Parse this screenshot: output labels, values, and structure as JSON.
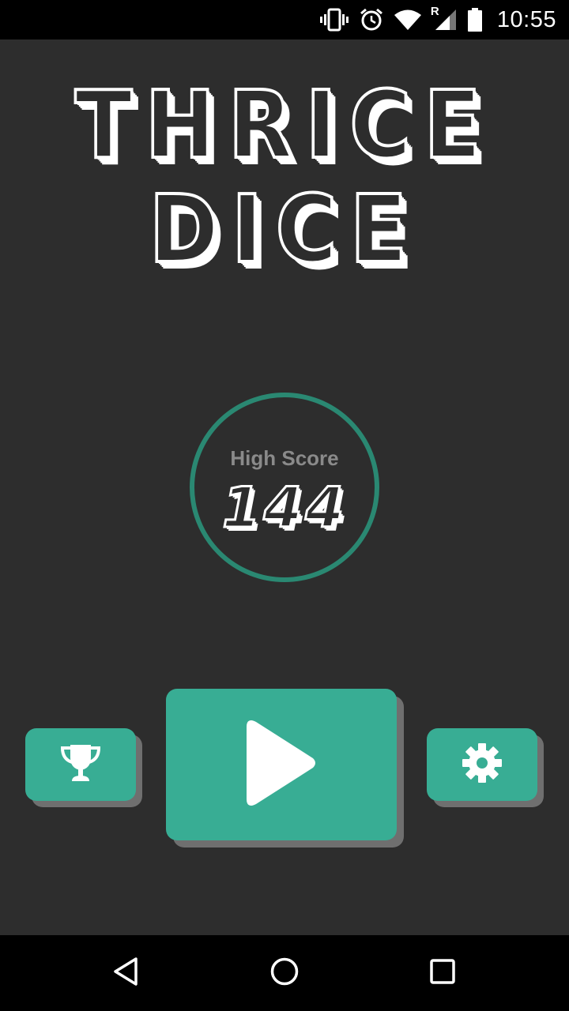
{
  "status_bar": {
    "time": "10:55",
    "roaming_indicator": "R",
    "icons": [
      "vibrate-icon",
      "alarm-icon",
      "wifi-icon",
      "signal-icon",
      "battery-icon"
    ]
  },
  "app": {
    "title_line1": "THRICE",
    "title_line2": "DICE"
  },
  "high_score": {
    "label": "High Score",
    "value": "144"
  },
  "buttons": {
    "leaderboard_icon": "trophy-icon",
    "play_icon": "play-icon",
    "settings_icon": "gear-icon"
  },
  "nav_bar": {
    "icons": [
      "back-icon",
      "home-icon",
      "recents-icon"
    ]
  },
  "colors": {
    "background": "#2d2d2d",
    "accent": "#38ad94",
    "ring": "#2a8872",
    "button_shadow": "#6f6f6f",
    "label": "#8a8a8a"
  }
}
